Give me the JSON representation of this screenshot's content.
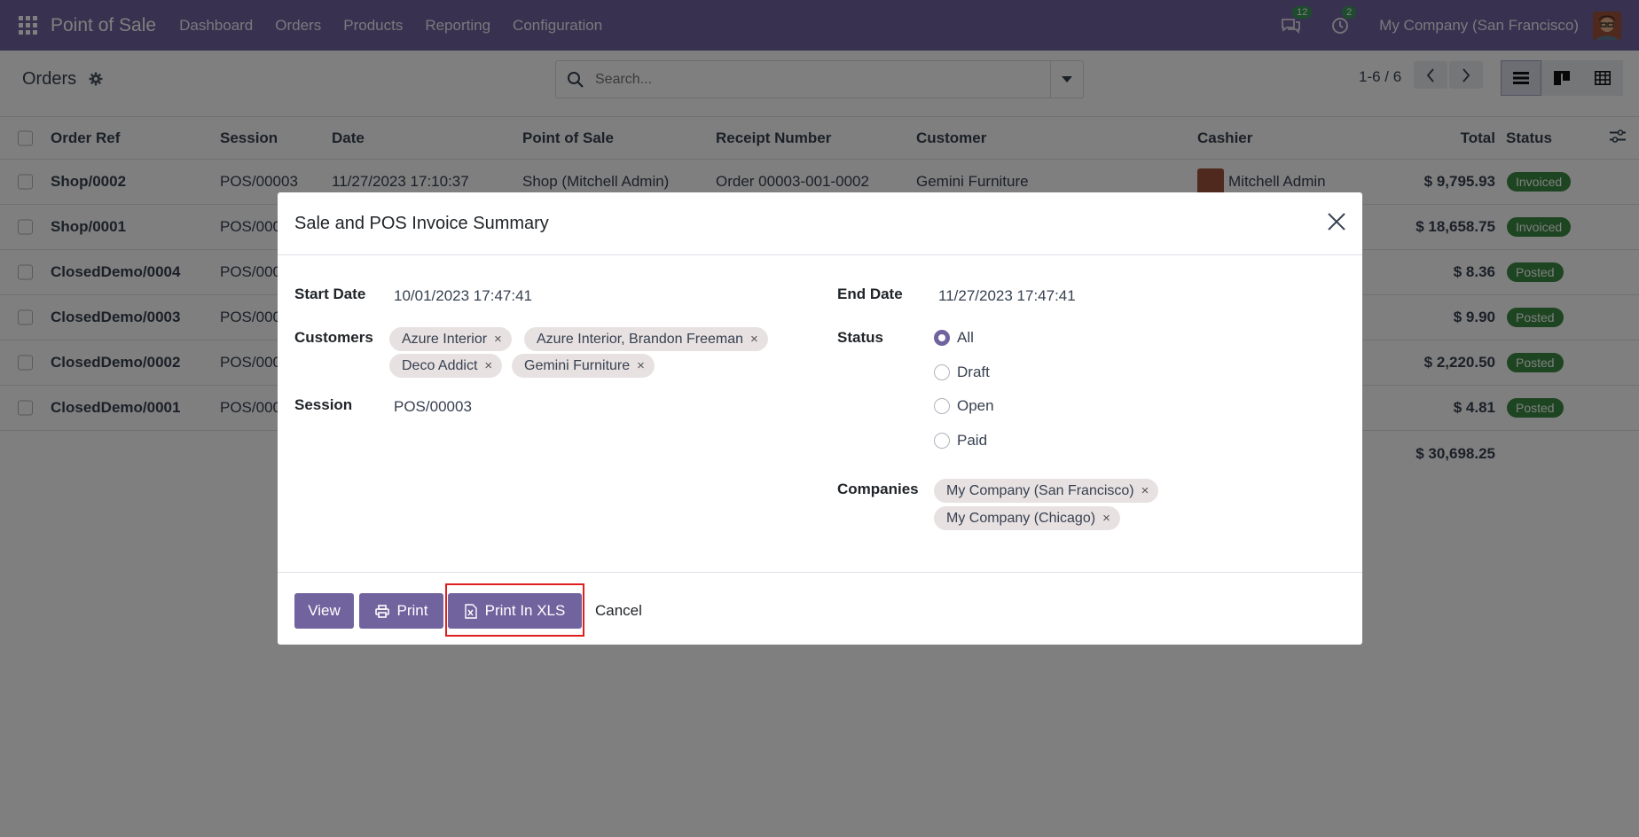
{
  "navbar": {
    "app_name": "Point of Sale",
    "menu": [
      "Dashboard",
      "Orders",
      "Products",
      "Reporting",
      "Configuration"
    ],
    "messages_count": "12",
    "activities_count": "2",
    "company": "My Company (San Francisco)"
  },
  "control_panel": {
    "title": "Orders",
    "search_placeholder": "Search...",
    "pager": "1-6 / 6"
  },
  "list": {
    "headers": {
      "order_ref": "Order Ref",
      "session": "Session",
      "date": "Date",
      "point_of_sale": "Point of Sale",
      "receipt_number": "Receipt Number",
      "customer": "Customer",
      "cashier": "Cashier",
      "total": "Total",
      "status": "Status"
    },
    "rows": [
      {
        "order_ref": "Shop/0002",
        "session": "POS/00003",
        "date": "11/27/2023 17:10:37",
        "pos": "Shop (Mitchell Admin)",
        "receipt": "Order 00003-001-0002",
        "customer": "Gemini Furniture",
        "cashier": "Mitchell Admin",
        "total": "$ 9,795.93",
        "status": "Invoiced"
      },
      {
        "order_ref": "Shop/0001",
        "session": "POS/000",
        "date": "",
        "pos": "",
        "receipt": "",
        "customer": "",
        "cashier": "",
        "total": "$ 18,658.75",
        "status": "Invoiced"
      },
      {
        "order_ref": "ClosedDemo/0004",
        "session": "POS/000",
        "date": "",
        "pos": "",
        "receipt": "",
        "customer": "",
        "cashier": "",
        "total": "$ 8.36",
        "status": "Posted"
      },
      {
        "order_ref": "ClosedDemo/0003",
        "session": "POS/000",
        "date": "",
        "pos": "",
        "receipt": "",
        "customer": "",
        "cashier": "",
        "total": "$ 9.90",
        "status": "Posted"
      },
      {
        "order_ref": "ClosedDemo/0002",
        "session": "POS/000",
        "date": "",
        "pos": "",
        "receipt": "",
        "customer": "",
        "cashier": "",
        "total": "$ 2,220.50",
        "status": "Posted"
      },
      {
        "order_ref": "ClosedDemo/0001",
        "session": "POS/000",
        "date": "",
        "pos": "",
        "receipt": "",
        "customer": "",
        "cashier": "",
        "total": "$ 4.81",
        "status": "Posted"
      }
    ],
    "grand_total": "$ 30,698.25"
  },
  "modal": {
    "title": "Sale and POS Invoice Summary",
    "start_date_label": "Start Date",
    "start_date": "10/01/2023 17:47:41",
    "end_date_label": "End Date",
    "end_date": "11/27/2023 17:47:41",
    "customers_label": "Customers",
    "customers": [
      "Azure Interior",
      "Azure Interior, Brandon Freeman",
      "Deco Addict",
      "Gemini Furniture"
    ],
    "session_label": "Session",
    "session": "POS/00003",
    "status_label": "Status",
    "status_options": [
      "All",
      "Draft",
      "Open",
      "Paid"
    ],
    "status_selected": "All",
    "companies_label": "Companies",
    "companies": [
      "My Company (San Francisco)",
      "My Company (Chicago)"
    ],
    "tag_remove": "×",
    "buttons": {
      "view": "View",
      "print": "Print",
      "print_xls": "Print In XLS",
      "cancel": "Cancel"
    }
  },
  "colors": {
    "brand": "#71639e",
    "invoiced_badge": "#3c8a43",
    "highlight": "#e02020"
  }
}
